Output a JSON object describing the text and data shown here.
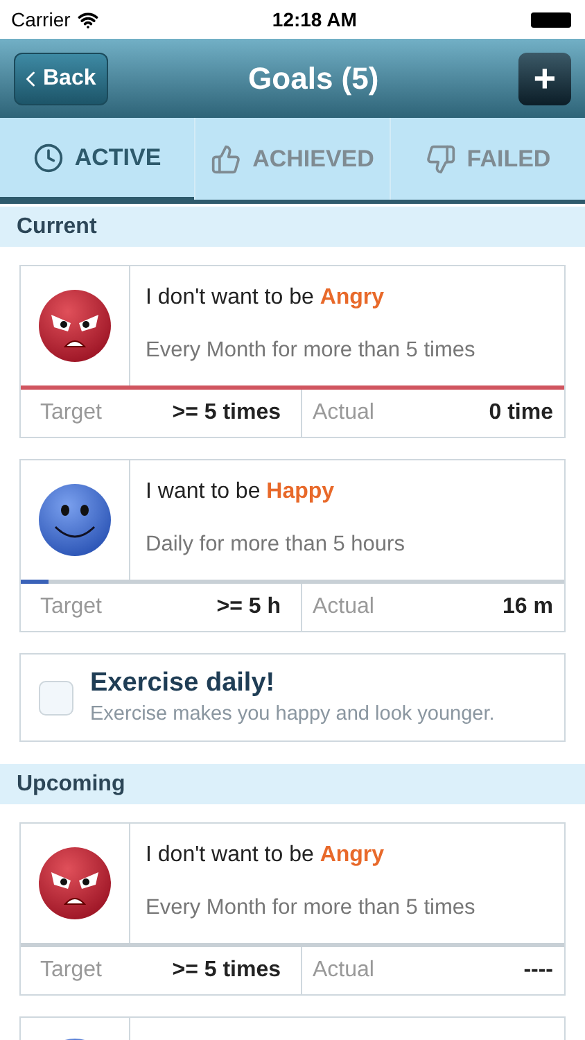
{
  "status_bar": {
    "carrier": "Carrier",
    "time": "12:18 AM"
  },
  "nav": {
    "back": "Back",
    "title": "Goals (5)",
    "add": "+"
  },
  "tabs": [
    {
      "label": "ACTIVE",
      "selected": true
    },
    {
      "label": "ACHIEVED",
      "selected": false
    },
    {
      "label": "FAILED",
      "selected": false
    }
  ],
  "sections": [
    {
      "title": "Current",
      "items": [
        {
          "kind": "goal",
          "face": {
            "kind": "angry"
          },
          "prefix": "I don't want to be",
          "emotion": "Angry",
          "frequency": "Every Month for more than 5 times",
          "level": 1,
          "color": "#d0555f",
          "target_label": "Target",
          "target": ">= 5 times",
          "actual_label": "Actual",
          "actual": "0 time"
        },
        {
          "kind": "goal",
          "face": {
            "kind": "happy"
          },
          "prefix": "I want to be",
          "emotion": "Happy",
          "frequency": "Daily for more than 5 hours",
          "level": 0.05,
          "color": "#3a62b8",
          "target_label": "Target",
          "target": ">= 5 h",
          "actual_label": "Actual",
          "actual": "16 m"
        },
        {
          "kind": "task",
          "title": "Exercise daily!",
          "note": "Exercise makes you happy and look younger.",
          "checked": false
        }
      ]
    },
    {
      "title": "Upcoming",
      "items": [
        {
          "kind": "goal",
          "face": {
            "kind": "angry"
          },
          "prefix": "I don't want to be",
          "emotion": "Angry",
          "frequency": "Every Month for more than 5 times",
          "target_label": "Target",
          "target": ">= 5 times",
          "actual_label": "Actual",
          "actual": "----"
        },
        {
          "kind": "peek",
          "face": {
            "kind": "happy"
          }
        }
      ]
    }
  ]
}
